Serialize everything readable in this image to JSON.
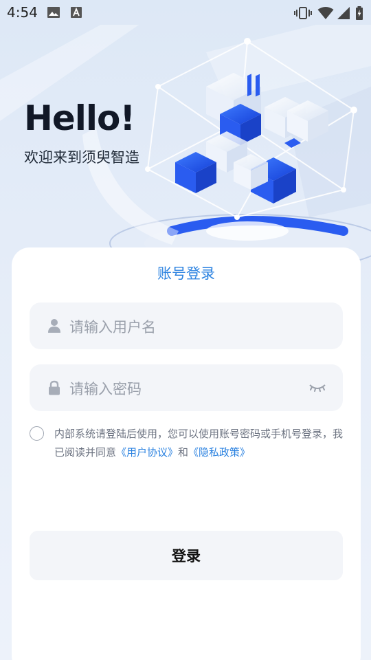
{
  "status_bar": {
    "time": "4:54"
  },
  "hero": {
    "greeting": "Hello!",
    "welcome": "欢迎来到须臾智造"
  },
  "login_card": {
    "title": "账号登录",
    "username": {
      "placeholder": "请输入用户名",
      "value": ""
    },
    "password": {
      "placeholder": "请输入密码",
      "value": ""
    },
    "agreement": {
      "prefix": "内部系统请登陆后使用，您可以使用账号密码或手机号登录，我已阅读并同意",
      "user_agreement": "《用户协议》",
      "conjunction": "和",
      "privacy_policy": "《隐私政策》",
      "checked": false
    },
    "submit_label": "登录"
  },
  "colors": {
    "accent": "#2b82e0",
    "field_bg": "#f3f5f9",
    "hero_blue": "#1f5bf0"
  }
}
